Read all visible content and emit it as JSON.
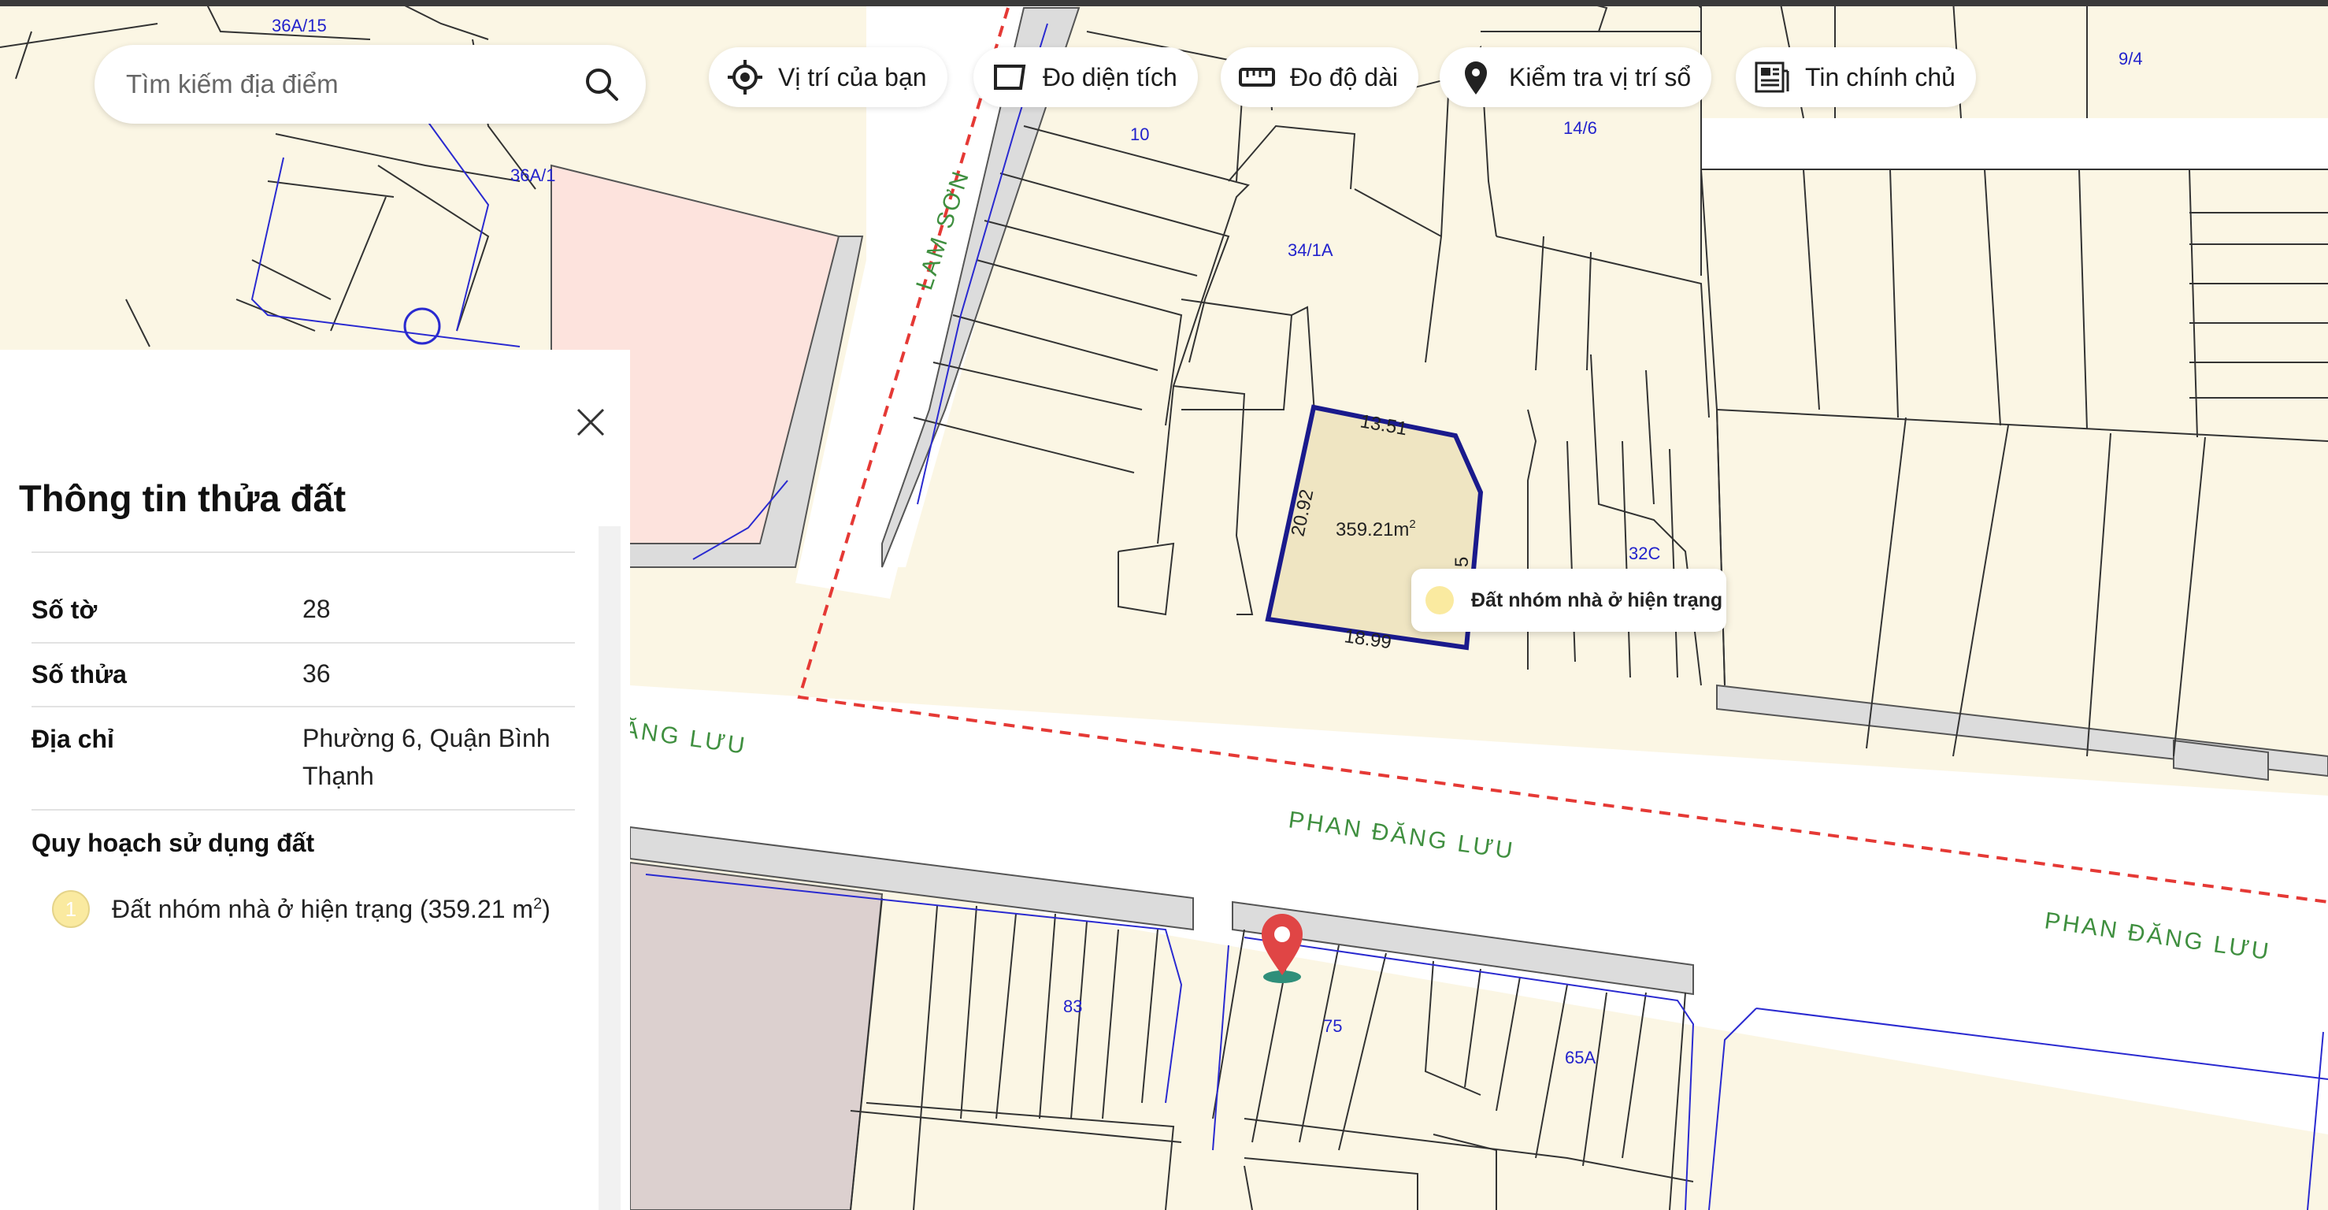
{
  "search": {
    "placeholder": "Tìm kiếm địa điểm"
  },
  "toolbar": {
    "location_label": "Vị trí của bạn",
    "measure_area_label": "Đo diện tích",
    "measure_length_label": "Đo độ dài",
    "check_position_label": "Kiểm tra vị trí sổ",
    "owner_listing_label": "Tin chính chủ"
  },
  "map": {
    "street_labels": [
      "LAM SƠN",
      "ĂNG LƯU",
      "PHAN ĐĂNG LƯU",
      "PHAN ĐĂNG LƯU"
    ],
    "parcel_labels": [
      "36A/15",
      "36A/1",
      "10",
      "14/6",
      "9/4",
      "34/1A",
      "32C",
      "83",
      "75",
      "65A"
    ],
    "selected_parcel": {
      "area": "359.21m",
      "area_sup": "2",
      "edge_top": "13.51",
      "edge_left": "20.92",
      "edge_bottom": "18.99",
      "edge_right": "5"
    },
    "tooltip_label": "Đất nhóm nhà ở hiện trạng"
  },
  "panel": {
    "title": "Thông tin thửa đất",
    "rows": [
      {
        "label": "Số tờ",
        "value": "28"
      },
      {
        "label": "Số thửa",
        "value": "36"
      },
      {
        "label": "Địa chỉ",
        "value": "Phường 6, Quận Bình Thạnh"
      }
    ],
    "planning_heading": "Quy hoạch sử dụng đất",
    "planning_items": [
      {
        "index": "1",
        "text": "Đất nhóm nhà ở hiện trạng (359.21 m",
        "sup": "2",
        "close": ")"
      }
    ]
  },
  "colors": {
    "parcel_fill": "#fbf6e4",
    "selected_fill": "#efe5c2",
    "selected_border": "#1a1a8c",
    "road_fill": "#ffffff",
    "sidewalk_fill": "#dcdcdc",
    "pink_zone": "#fde3dd",
    "mauve_zone": "#dcd0cf",
    "boundary_dash": "#e53935",
    "street_label": "#3f8f3f",
    "parcel_label": "#2222cc",
    "marker": "#e04545"
  },
  "icons": [
    "search-icon",
    "locate-icon",
    "area-icon",
    "ruler-icon",
    "pin-icon",
    "news-icon",
    "close-icon",
    "map-marker-icon"
  ]
}
